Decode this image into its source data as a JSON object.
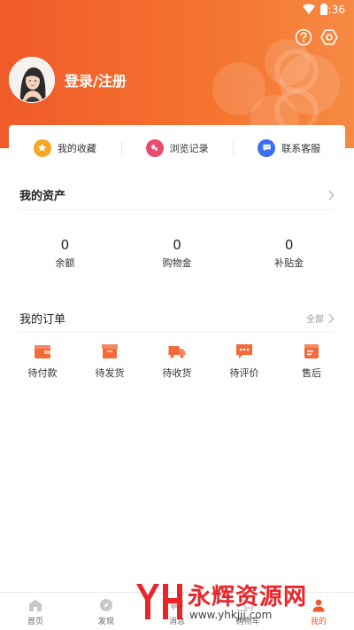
{
  "status_bar": {
    "time": "9:36"
  },
  "header": {
    "login_label": "登录/注册"
  },
  "quick_links": [
    {
      "label": "我的收藏",
      "icon": "star-icon",
      "color": "#f5a623"
    },
    {
      "label": "浏览记录",
      "icon": "footprint-icon",
      "color": "#e84c6f"
    },
    {
      "label": "联系客服",
      "icon": "chat-icon",
      "color": "#3d6ff0"
    }
  ],
  "assets": {
    "title": "我的资产",
    "items": [
      {
        "value": "0",
        "label": "余额"
      },
      {
        "value": "0",
        "label": "购物金"
      },
      {
        "value": "0",
        "label": "补贴金"
      }
    ]
  },
  "orders": {
    "title": "我的订单",
    "all_label": "全部",
    "items": [
      {
        "label": "待付款",
        "icon": "wallet-icon"
      },
      {
        "label": "待发货",
        "icon": "box-icon"
      },
      {
        "label": "待收货",
        "icon": "truck-icon"
      },
      {
        "label": "待评价",
        "icon": "comment-icon"
      },
      {
        "label": "售后",
        "icon": "after-sale-icon"
      }
    ]
  },
  "bottom_nav": [
    {
      "label": "首页",
      "icon": "home-icon"
    },
    {
      "label": "发现",
      "icon": "compass-icon"
    },
    {
      "label": "消息",
      "icon": "message-icon"
    },
    {
      "label": "购物车",
      "icon": "cart-icon"
    },
    {
      "label": "我的",
      "icon": "user-icon",
      "active": true
    }
  ],
  "watermark": {
    "text": "永辉资源网",
    "url": "www.yhkjjj.com"
  },
  "colors": {
    "accent": "#f05a2a",
    "accent_light": "#f68a43",
    "icon_orange": "#f26b3a"
  }
}
